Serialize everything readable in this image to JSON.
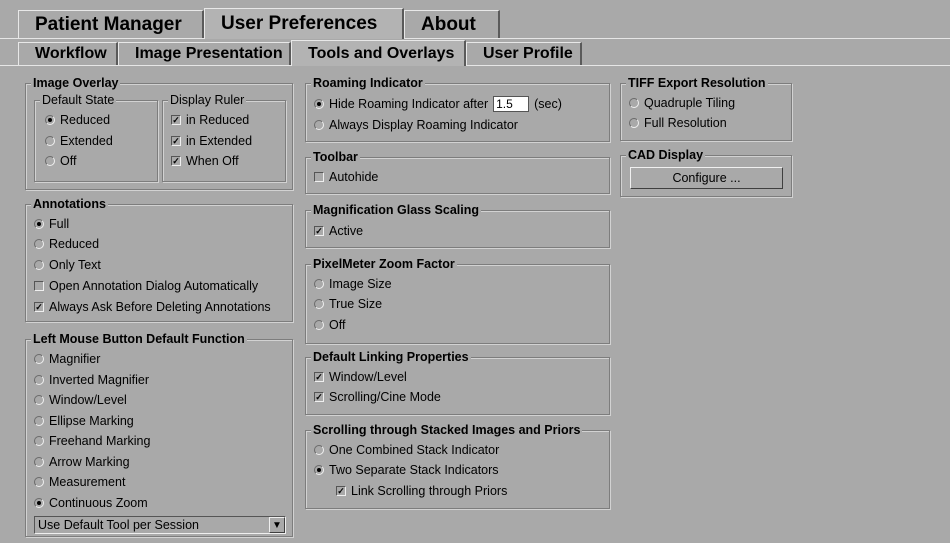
{
  "main_tabs": [
    {
      "label": "Patient Manager"
    },
    {
      "label": "User Preferences"
    },
    {
      "label": "About"
    }
  ],
  "sub_tabs": [
    {
      "label": "Workflow"
    },
    {
      "label": "Image Presentation"
    },
    {
      "label": "Tools and Overlays"
    },
    {
      "label": "User Profile"
    }
  ],
  "image_overlay": {
    "title": "Image Overlay",
    "default_state": {
      "title": "Default State",
      "options": [
        {
          "label": "Reduced",
          "selected": true
        },
        {
          "label": "Extended",
          "selected": false
        },
        {
          "label": "Off",
          "selected": false
        }
      ]
    },
    "display_ruler": {
      "title": "Display Ruler",
      "options": [
        {
          "label": "in Reduced",
          "checked": true
        },
        {
          "label": "in Extended",
          "checked": true
        },
        {
          "label": "When Off",
          "checked": true
        }
      ]
    }
  },
  "annotations": {
    "title": "Annotations",
    "radios": [
      {
        "label": "Full",
        "selected": true
      },
      {
        "label": "Reduced",
        "selected": false
      },
      {
        "label": "Only Text",
        "selected": false
      }
    ],
    "checks": [
      {
        "label": "Open Annotation Dialog Automatically",
        "checked": false
      },
      {
        "label": "Always Ask Before Deleting Annotations",
        "checked": true
      }
    ]
  },
  "left_mouse": {
    "title": "Left Mouse Button Default Function",
    "options": [
      {
        "label": "Magnifier",
        "selected": false
      },
      {
        "label": "Inverted Magnifier",
        "selected": false
      },
      {
        "label": "Window/Level",
        "selected": false
      },
      {
        "label": "Ellipse Marking",
        "selected": false
      },
      {
        "label": "Freehand Marking",
        "selected": false
      },
      {
        "label": "Arrow Marking",
        "selected": false
      },
      {
        "label": "Measurement",
        "selected": false
      },
      {
        "label": "Continuous Zoom",
        "selected": true
      }
    ],
    "select_value": "Use Default Tool per Session"
  },
  "roaming": {
    "title": "Roaming Indicator",
    "hide_label": "Hide Roaming Indicator after",
    "hide_value": "1.5",
    "unit": "(sec)",
    "always_label": "Always Display Roaming Indicator"
  },
  "toolbar": {
    "title": "Toolbar",
    "autohide_label": "Autohide"
  },
  "magnification": {
    "title": "Magnification Glass Scaling",
    "active_label": "Active"
  },
  "pixelmeter": {
    "title": "PixelMeter Zoom Factor",
    "options": [
      {
        "label": "Image Size",
        "selected": false
      },
      {
        "label": "True Size",
        "selected": true
      },
      {
        "label": "Off",
        "selected": false
      }
    ]
  },
  "linking": {
    "title": "Default Linking Properties",
    "options": [
      {
        "label": "Window/Level",
        "checked": true
      },
      {
        "label": "Scrolling/Cine Mode",
        "checked": true
      }
    ]
  },
  "scrolling": {
    "title": "Scrolling through Stacked Images and Priors",
    "options": [
      {
        "label": "One Combined Stack Indicator",
        "selected": false
      },
      {
        "label": "Two Separate Stack Indicators",
        "selected": true
      }
    ],
    "link_label": "Link Scrolling through Priors"
  },
  "tiff": {
    "title": "TIFF Export Resolution",
    "options": [
      {
        "label": "Quadruple Tiling",
        "selected": false
      },
      {
        "label": "Full Resolution",
        "selected": true
      }
    ]
  },
  "cad": {
    "title": "CAD Display",
    "button_label": "Configure ..."
  },
  "glyphs": {
    "check_mark": "✓",
    "dropdown_arrow": "▼"
  }
}
